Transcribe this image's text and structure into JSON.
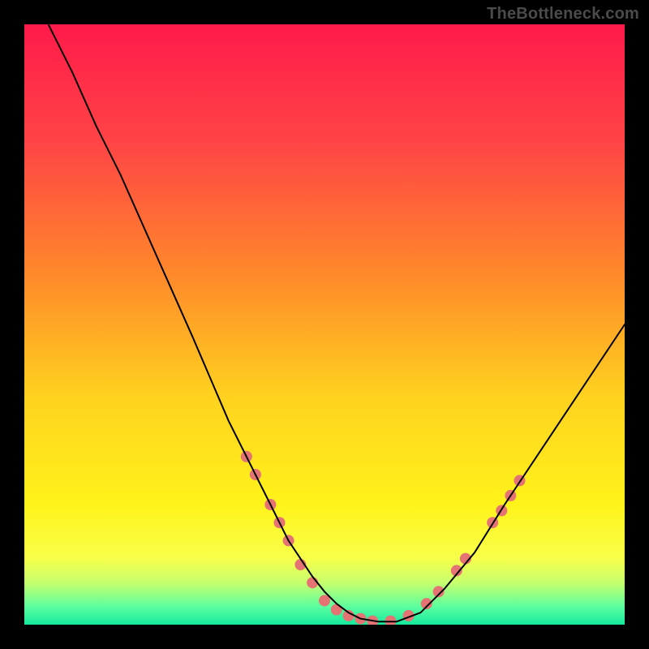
{
  "watermark": "TheBottleneck.com",
  "chart_data": {
    "type": "line",
    "title": "",
    "xlabel": "",
    "ylabel": "",
    "xlim": [
      0,
      100
    ],
    "ylim": [
      0,
      100
    ],
    "grid": false,
    "background_gradient": {
      "stops": [
        {
          "pos": 0.0,
          "color": "#ff1a4b"
        },
        {
          "pos": 0.2,
          "color": "#ff4545"
        },
        {
          "pos": 0.42,
          "color": "#ff8a2a"
        },
        {
          "pos": 0.62,
          "color": "#ffd21f"
        },
        {
          "pos": 0.8,
          "color": "#fff31a"
        },
        {
          "pos": 0.89,
          "color": "#f7ff4a"
        },
        {
          "pos": 0.93,
          "color": "#c7ff6e"
        },
        {
          "pos": 0.97,
          "color": "#5cff9e"
        },
        {
          "pos": 1.0,
          "color": "#14e99e"
        }
      ]
    },
    "series": [
      {
        "name": "bottleneck-curve",
        "color": "#000000",
        "stroke_width": 2,
        "x": [
          4,
          8,
          12,
          16,
          20,
          24,
          28,
          31,
          34,
          37,
          40,
          42,
          44,
          46,
          48,
          50,
          52,
          54,
          56,
          59,
          62,
          66,
          70,
          75,
          80,
          86,
          92,
          100
        ],
        "y": [
          100,
          92,
          83,
          75,
          66,
          57,
          48,
          41,
          34,
          28,
          22,
          18,
          14,
          11,
          8,
          5.5,
          3.5,
          2,
          1,
          0.5,
          0.5,
          2,
          6,
          12,
          20,
          29,
          38,
          50
        ]
      }
    ],
    "markers": {
      "name": "highlight-dots",
      "color": "#e57373",
      "radius": 7,
      "points": [
        {
          "x": 37,
          "y": 28
        },
        {
          "x": 38.5,
          "y": 25
        },
        {
          "x": 41,
          "y": 20
        },
        {
          "x": 42.5,
          "y": 17
        },
        {
          "x": 44,
          "y": 14
        },
        {
          "x": 46,
          "y": 10
        },
        {
          "x": 48,
          "y": 7
        },
        {
          "x": 50,
          "y": 4
        },
        {
          "x": 52,
          "y": 2.5
        },
        {
          "x": 54,
          "y": 1.5
        },
        {
          "x": 56,
          "y": 1
        },
        {
          "x": 58,
          "y": 0.6
        },
        {
          "x": 61,
          "y": 0.6
        },
        {
          "x": 64,
          "y": 1.5
        },
        {
          "x": 67,
          "y": 3.5
        },
        {
          "x": 69,
          "y": 5.5
        },
        {
          "x": 72,
          "y": 9
        },
        {
          "x": 73.5,
          "y": 11
        },
        {
          "x": 78,
          "y": 17
        },
        {
          "x": 79.5,
          "y": 19
        },
        {
          "x": 81,
          "y": 21.5
        },
        {
          "x": 82.5,
          "y": 24
        }
      ]
    }
  }
}
